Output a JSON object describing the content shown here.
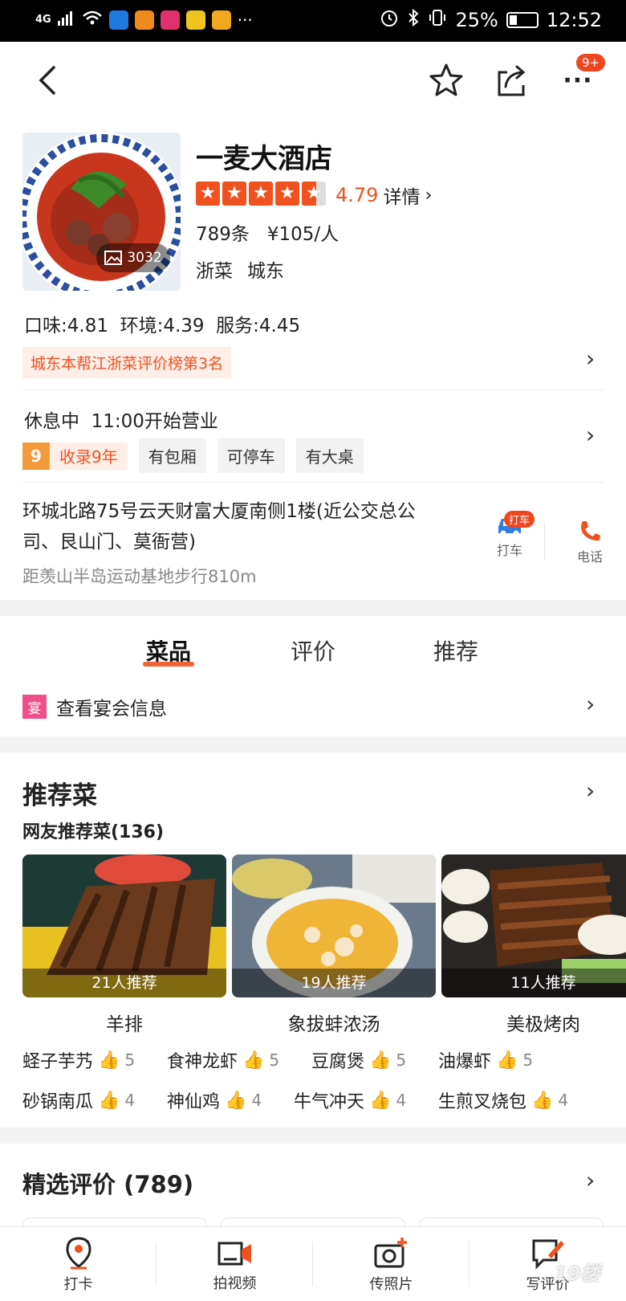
{
  "status_bar": {
    "network": "4G",
    "battery": "25%",
    "time": "12:52"
  },
  "header": {
    "more_badge": "9+"
  },
  "shop": {
    "name": "一麦大酒店",
    "rating": "4.79",
    "details_link": "详情",
    "reviews_and_price": "789条   ¥105/人",
    "cuisine": "浙菜",
    "area": "城东",
    "photo_count": "3032",
    "scores": "口味:4.81  环境:4.39  服务:4.45",
    "ranking": "城东本帮江浙菜评价榜第3名",
    "status": "休息中  11:00开始营业",
    "years_badge": "9",
    "years_label": "收录9年",
    "tags": [
      "有包厢",
      "可停车",
      "有大桌"
    ],
    "address": "环城北路75号云天财富大厦南侧1楼(近公交总公司、艮山门、莫衙营)",
    "distance": "距羡山半岛运动基地步行810m",
    "taxi_label": "打车",
    "taxi_badge": "打车",
    "phone_label": "电话"
  },
  "tabs": {
    "dishes": "菜品",
    "reviews": "评价",
    "recommend": "推荐"
  },
  "banquet": {
    "icon_text": "宴",
    "label": "查看宴会信息"
  },
  "recommended": {
    "title": "推荐菜",
    "subtitle": "网友推荐菜(136)",
    "cards": [
      {
        "name": "羊排",
        "caption": "21人推荐"
      },
      {
        "name": "象拔蚌浓汤",
        "caption": "19人推荐"
      },
      {
        "name": "美极烤肉",
        "caption": "11人推荐"
      }
    ],
    "more": [
      {
        "name": "蛏子芋艿",
        "count": "5"
      },
      {
        "name": "食神龙虾",
        "count": "5"
      },
      {
        "name": "豆腐煲",
        "count": "5"
      },
      {
        "name": "油爆虾",
        "count": "5"
      },
      {
        "name": "砂锅南瓜",
        "count": "4"
      },
      {
        "name": "神仙鸡",
        "count": "4"
      },
      {
        "name": "牛气冲天",
        "count": "4"
      },
      {
        "name": "生煎叉烧包",
        "count": "4"
      }
    ]
  },
  "reviews_section": {
    "title": "精选评价 (789)"
  },
  "bottom_bar": {
    "checkin": "打卡",
    "video": "拍视频",
    "photo": "传照片",
    "write_review": "写评价"
  },
  "watermark": "19楼"
}
